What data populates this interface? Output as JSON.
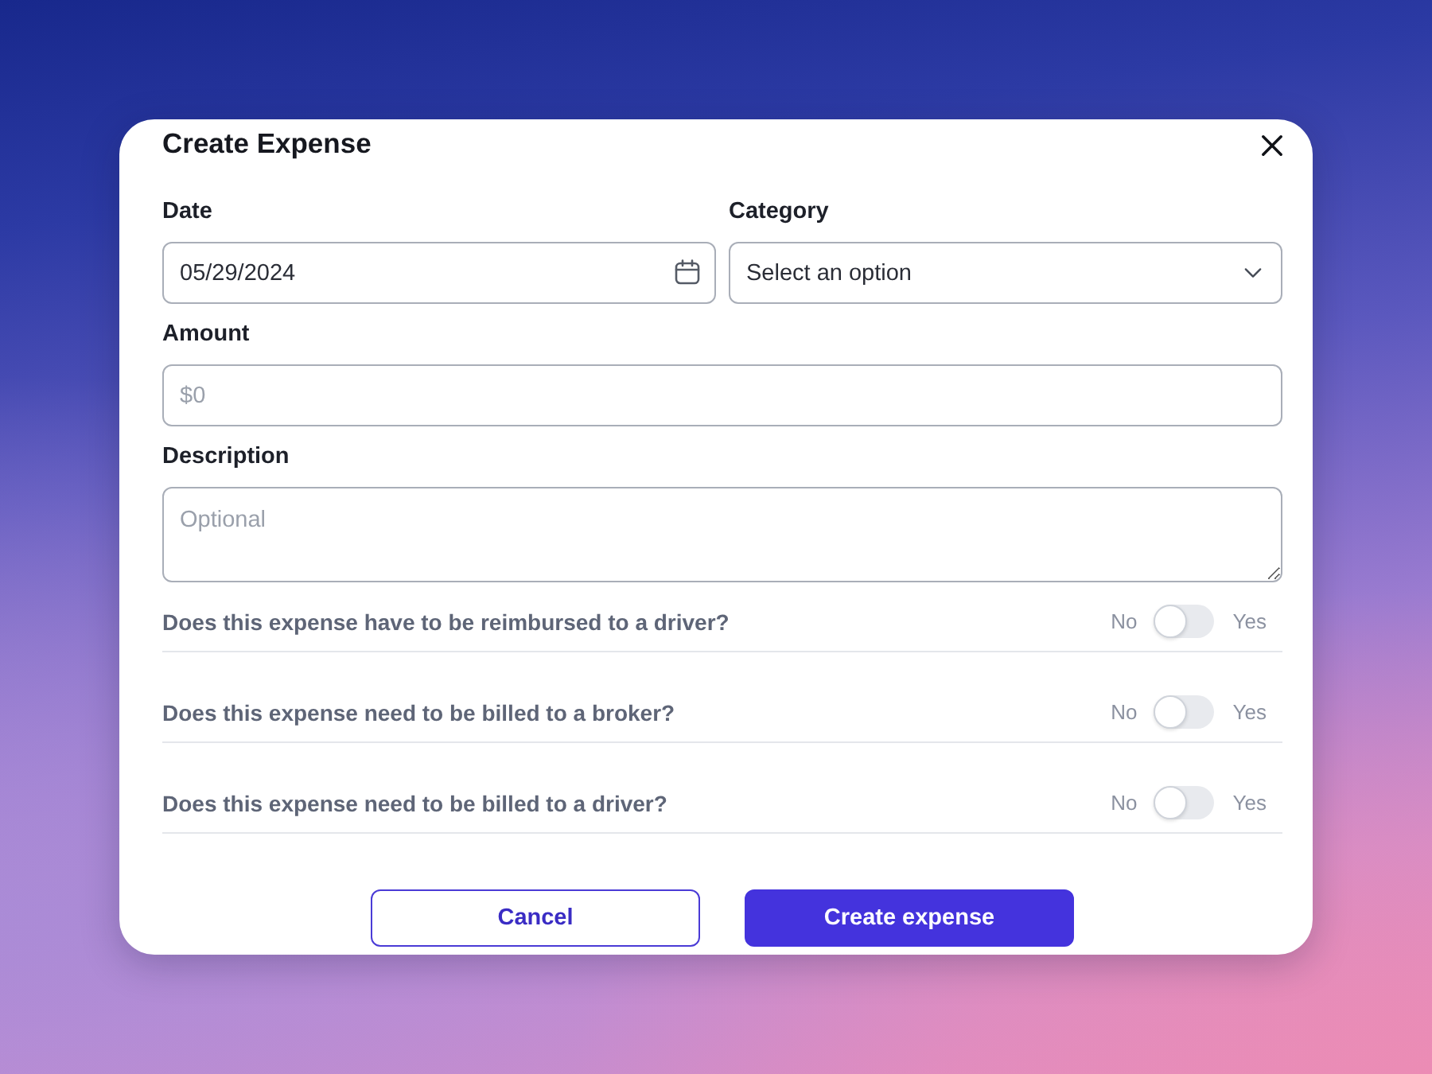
{
  "dialog": {
    "title": "Create Expense"
  },
  "form_rows": [
    [
      {
        "kind": "date",
        "label": "Date",
        "value": "05/29/2024"
      },
      {
        "kind": "select",
        "label": "Category",
        "placeholder": "Select an option"
      }
    ],
    [
      {
        "kind": "currency",
        "label": "Amount",
        "placeholder": "$0"
      }
    ],
    [
      {
        "kind": "textarea",
        "label": "Description",
        "placeholder": "Optional"
      }
    ]
  ],
  "questions": [
    {
      "text": "Does this expense have to be reimbursed to a driver?",
      "off_label": "No",
      "on_label": "Yes",
      "on": false
    },
    {
      "text": "Does this expense need to be billed to a broker?",
      "off_label": "No",
      "on_label": "Yes",
      "on": false
    },
    {
      "text": "Does this expense need to be billed to a driver?",
      "off_label": "No",
      "on_label": "Yes",
      "on": false
    }
  ],
  "buttons": [
    {
      "kind": "cancel",
      "label": "Cancel"
    },
    {
      "kind": "submit",
      "label": "Create expense"
    }
  ]
}
